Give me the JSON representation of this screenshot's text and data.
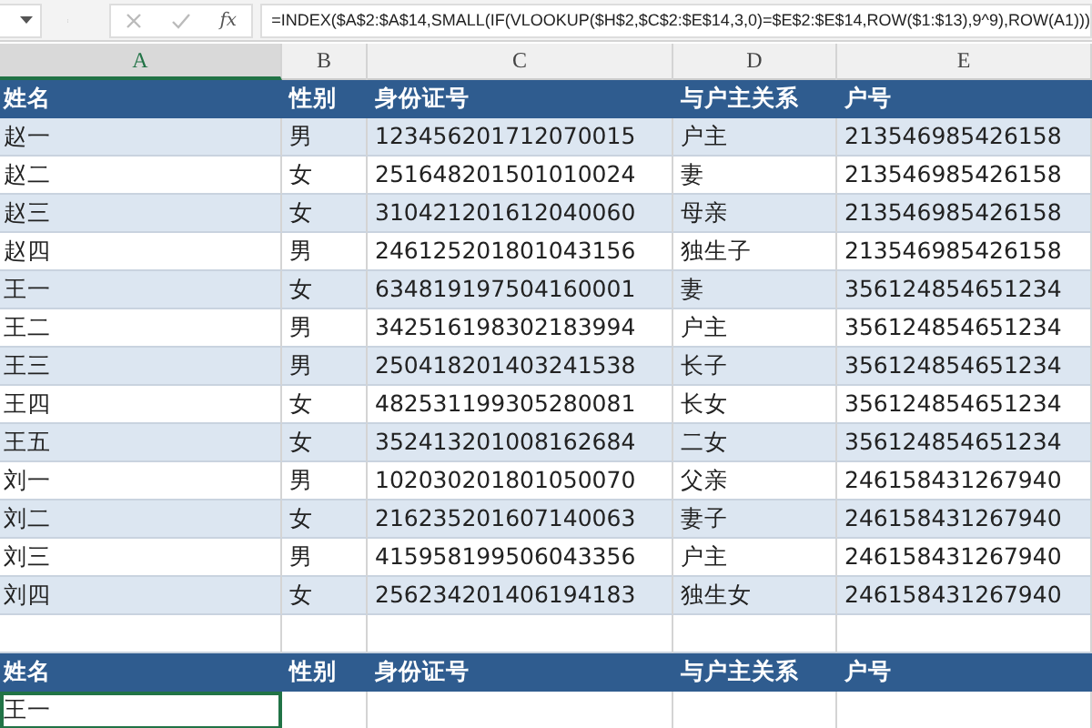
{
  "formula_bar": {
    "function_label": "fx",
    "formula": "=INDEX($A$2:$A$14,SMALL(IF(VLOOKUP($H$2,$C$2:$E$14,3,0)=$E$2:$E$14,ROW($1:$13),9^9),ROW(A1)))"
  },
  "columns": [
    {
      "label": "A",
      "selected": true
    },
    {
      "label": "B",
      "selected": false
    },
    {
      "label": "C",
      "selected": false
    },
    {
      "label": "D",
      "selected": false
    },
    {
      "label": "E",
      "selected": false
    }
  ],
  "source_table": {
    "header": [
      "姓名",
      "性别",
      "身份证号",
      "与户主关系",
      "户号"
    ],
    "rows": [
      [
        "赵一",
        "男",
        "123456201712070015",
        "户主",
        "213546985426158"
      ],
      [
        "赵二",
        "女",
        "251648201501010024",
        "妻",
        "213546985426158"
      ],
      [
        "赵三",
        "女",
        "310421201612040060",
        "母亲",
        "213546985426158"
      ],
      [
        "赵四",
        "男",
        "246125201801043156",
        "独生子",
        "213546985426158"
      ],
      [
        "王一",
        "女",
        "634819197504160001",
        "妻",
        "356124854651234"
      ],
      [
        "王二",
        "男",
        "342516198302183994",
        "户主",
        "356124854651234"
      ],
      [
        "王三",
        "男",
        "250418201403241538",
        "长子",
        "356124854651234"
      ],
      [
        "王四",
        "女",
        "482531199305280081",
        "长女",
        "356124854651234"
      ],
      [
        "王五",
        "女",
        "352413201008162684",
        "二女",
        "356124854651234"
      ],
      [
        "刘一",
        "男",
        "102030201801050070",
        "父亲",
        "246158431267940"
      ],
      [
        "刘二",
        "女",
        "216235201607140063",
        "妻子",
        "246158431267940"
      ],
      [
        "刘三",
        "男",
        "415958199506043356",
        "户主",
        "246158431267940"
      ],
      [
        "刘四",
        "女",
        "256234201406194183",
        "独生女",
        "246158431267940"
      ]
    ]
  },
  "result_table": {
    "header": [
      "姓名",
      "性别",
      "身份证号",
      "与户主关系",
      "户号"
    ],
    "rows": [
      {
        "cells": [
          {
            "text": "王一",
            "selected": true
          }
        ]
      }
    ]
  }
}
